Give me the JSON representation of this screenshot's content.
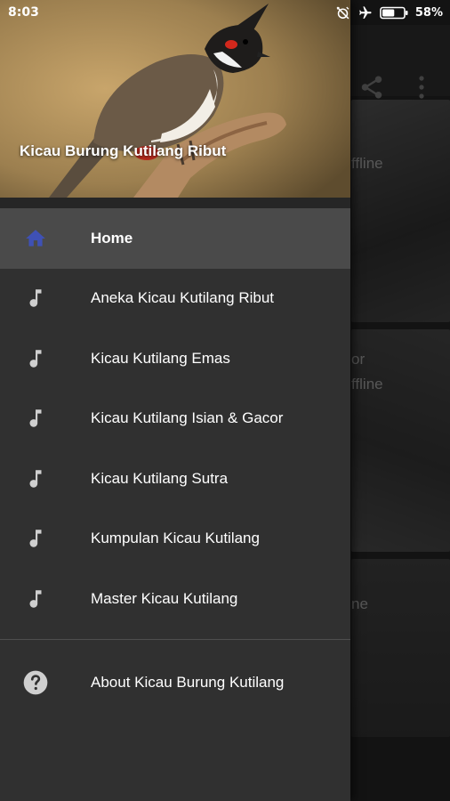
{
  "status_bar": {
    "time": "8:03",
    "battery_percent": "58%",
    "icons": [
      "alarm-off-icon",
      "airplane-icon",
      "battery-icon"
    ]
  },
  "drawer": {
    "header_title": "Kicau Burung Kutilang Ribut",
    "menu": [
      {
        "label": "Home",
        "icon": "home-icon",
        "active": true
      },
      {
        "label": "Aneka Kicau Kutilang Ribut",
        "icon": "music-note-icon"
      },
      {
        "label": "Kicau Kutilang Emas",
        "icon": "music-note-icon"
      },
      {
        "label": "Kicau Kutilang Isian & Gacor",
        "icon": "music-note-icon"
      },
      {
        "label": "Kicau Kutilang Sutra",
        "icon": "music-note-icon"
      },
      {
        "label": "Kumpulan Kicau Kutilang",
        "icon": "music-note-icon"
      },
      {
        "label": "Master Kicau Kutilang",
        "icon": "music-note-icon"
      }
    ],
    "about": {
      "label": "About Kicau Burung Kutilang",
      "icon": "help-icon"
    }
  },
  "background": {
    "toolbar_icons": [
      "share-icon",
      "more-vert-icon"
    ],
    "fragments": [
      "ffline",
      "or",
      "ffline",
      "ne"
    ]
  },
  "colors": {
    "active_icon": "#3f51b5",
    "drawer_bg": "#303030",
    "active_row_bg": "#4a4a4a",
    "icon_gray": "#cfcfcf"
  }
}
